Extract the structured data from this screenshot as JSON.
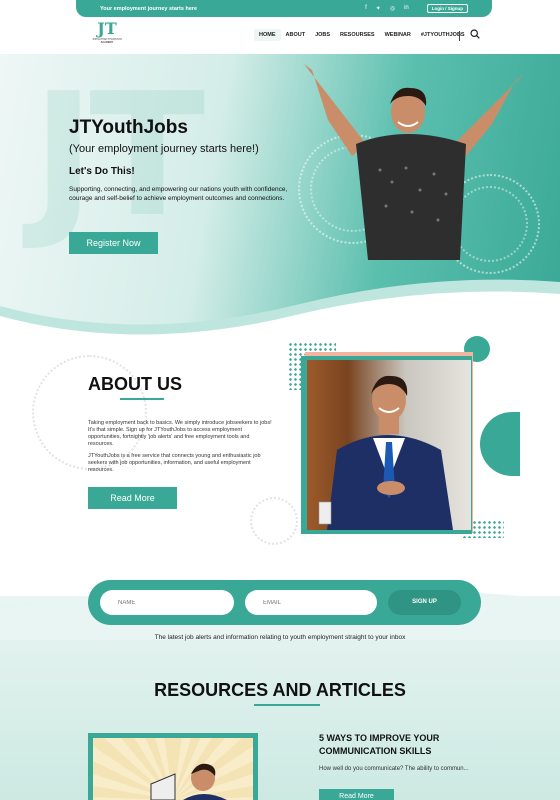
{
  "topbar": {
    "tagline": "Your employment journey starts here",
    "socials": [
      "facebook-icon",
      "twitter-icon",
      "instagram-icon",
      "linkedin-icon"
    ],
    "login_label": "Login / Signup"
  },
  "logo": {
    "mark": "JT",
    "line1": "JOHNATHAN THURSTON",
    "line2": "ACADEMY"
  },
  "nav": {
    "items": [
      "HOME",
      "ABOUT",
      "JOBS",
      "RESOURSES",
      "WEBINAR",
      "#JTYOUTHJOBS"
    ],
    "active": "HOME"
  },
  "hero": {
    "title": "JTYouthJobs",
    "subtitle": "(Your employment journey starts here!)",
    "heading": "Let's Do This!",
    "text": "Supporting, connecting, and empowering our nations youth with confidence, courage and self-belief to achieve employment outcomes and connections.",
    "cta": "Register Now",
    "watermark": "JT"
  },
  "about": {
    "heading": "ABOUT US",
    "para1": "Taking employment back to basics. We simply introduce jobseekers to jobs! It's that simple. Sign up for JTYouthJobs to access employment opportunities, fortnightly 'job alerts' and free employment tools and resources.",
    "para2": "JTYouthJobs is a free service that connects young and enthusiastic job seekers with job opportunities, information, and useful employment resources.",
    "cta": "Read More"
  },
  "signup": {
    "name_placeholder": "NAME",
    "email_placeholder": "EMAIL",
    "button": "SIGN UP",
    "note": "The latest job alerts and information relating to youth employment straight to your inbox"
  },
  "resources": {
    "heading": "RESOURCES AND ARTICLES",
    "article": {
      "title": "5 WAYS TO IMPROVE YOUR COMMUNICATION SKILLS",
      "excerpt": "How well do you communicate? The ability to commun...",
      "cta": "Read More"
    }
  },
  "colors": {
    "accent": "#3aa896",
    "peach": "#f3b5a0"
  }
}
